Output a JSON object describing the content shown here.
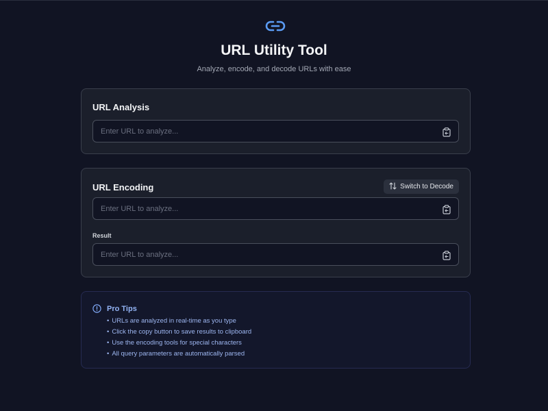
{
  "header": {
    "logo_icon": "link-icon",
    "title": "URL Utility Tool",
    "subtitle": "Analyze, encode, and decode URLs with ease"
  },
  "analysis": {
    "title": "URL Analysis",
    "input_placeholder": "Enter URL to analyze...",
    "input_value": "",
    "copy_icon": "clipboard-icon"
  },
  "encoding": {
    "title": "URL Encoding",
    "switch_label": "Switch to Decode",
    "switch_icon": "swap-vertical-icon",
    "input_placeholder": "Enter URL to analyze...",
    "input_value": "",
    "result_label": "Result",
    "result_placeholder": "Enter URL to analyze...",
    "result_value": ""
  },
  "tips": {
    "icon": "info-icon",
    "title": "Pro Tips",
    "items": [
      "URLs are analyzed in real-time as you type",
      "Click the copy button to save results to clipboard",
      "Use the encoding tools for special characters",
      "All query parameters are automatically parsed"
    ]
  },
  "colors": {
    "background": "#111423",
    "card": "#1b1f2b",
    "accent": "#5b9cf5",
    "tips_text": "#9db6f0"
  }
}
